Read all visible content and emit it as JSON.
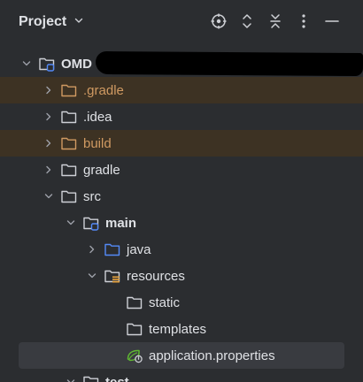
{
  "header": {
    "title": "Project",
    "actions": [
      {
        "name": "locate-icon"
      },
      {
        "name": "expand-all-icon"
      },
      {
        "name": "collapse-all-icon"
      },
      {
        "name": "more-options-icon"
      },
      {
        "name": "hide-panel-icon"
      }
    ]
  },
  "tree": {
    "rows": [
      {
        "label": "OMD",
        "depth": 0,
        "expanded": true,
        "icon": "module-folder-icon",
        "bold": true
      },
      {
        "label": ".gradle",
        "depth": 1,
        "expanded": false,
        "icon": "folder-icon",
        "excluded": true
      },
      {
        "label": ".idea",
        "depth": 1,
        "expanded": false,
        "icon": "folder-icon"
      },
      {
        "label": "build",
        "depth": 1,
        "expanded": false,
        "icon": "folder-icon",
        "excluded": true
      },
      {
        "label": "gradle",
        "depth": 1,
        "expanded": false,
        "icon": "folder-icon"
      },
      {
        "label": "src",
        "depth": 1,
        "expanded": true,
        "icon": "folder-icon"
      },
      {
        "label": "main",
        "depth": 2,
        "expanded": true,
        "icon": "module-folder-icon",
        "bold": true
      },
      {
        "label": "java",
        "depth": 3,
        "expanded": false,
        "icon": "source-folder-icon"
      },
      {
        "label": "resources",
        "depth": 3,
        "expanded": true,
        "icon": "resources-folder-icon"
      },
      {
        "label": "static",
        "depth": 4,
        "icon": "folder-icon"
      },
      {
        "label": "templates",
        "depth": 4,
        "icon": "folder-icon"
      },
      {
        "label": "application.properties",
        "depth": 4,
        "icon": "spring-properties-icon",
        "selected": true
      },
      {
        "label": "test",
        "depth": 2,
        "expanded": true,
        "icon": "module-folder-icon",
        "bold": true
      }
    ]
  },
  "colors": {
    "background": "#2b2d30",
    "excluded_row": "#3d3223",
    "excluded_text": "#d09a62",
    "selected_row": "#393b40",
    "source_folder": "#548af7",
    "spring_green": "#5fb832"
  }
}
